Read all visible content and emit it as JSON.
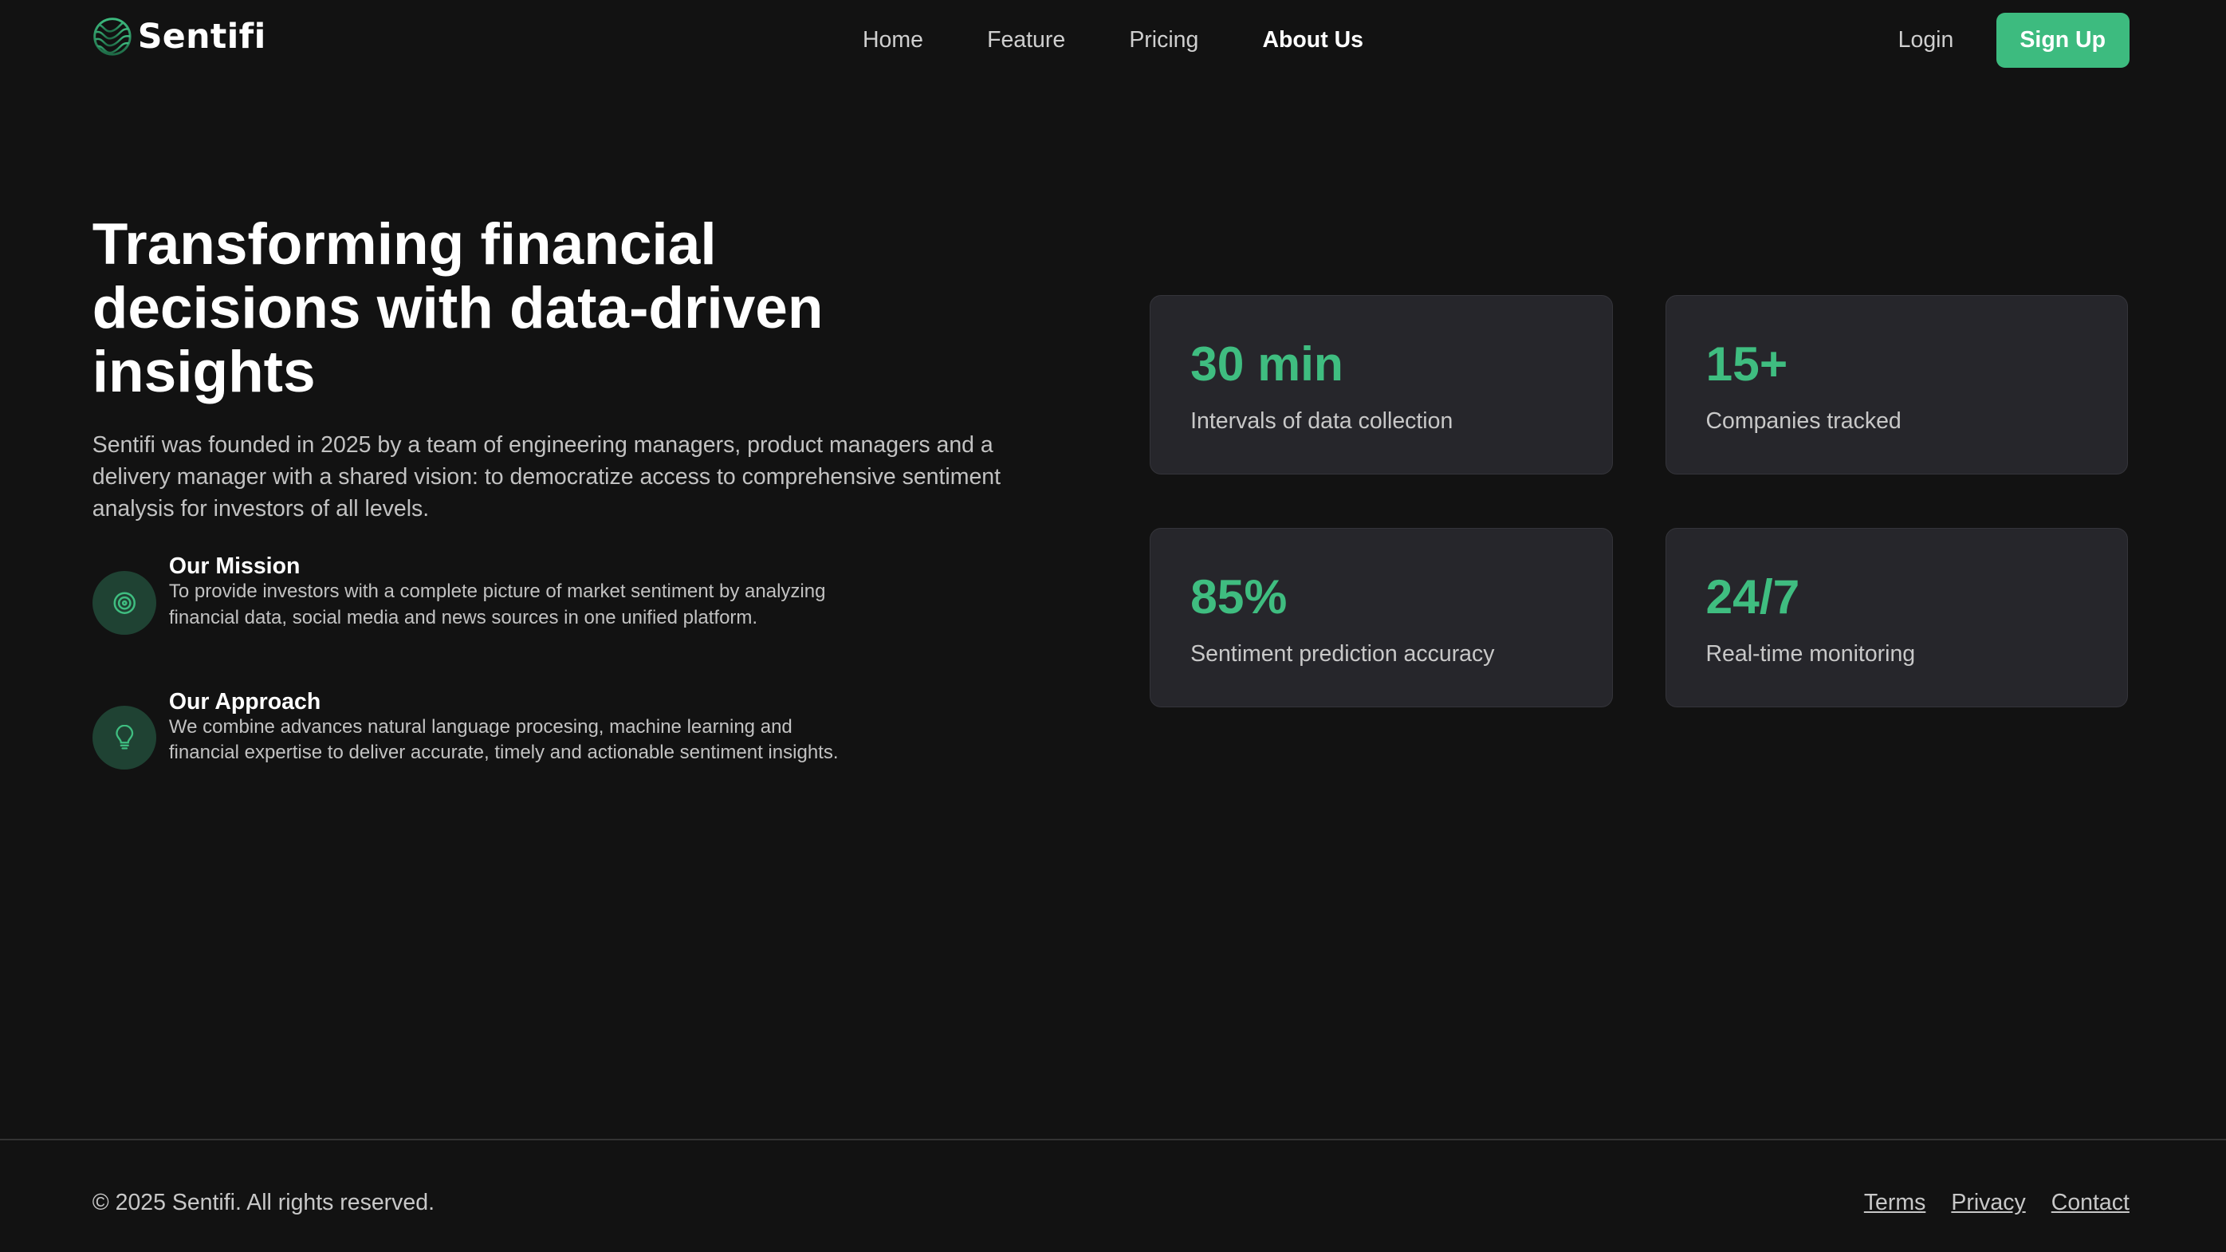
{
  "brand": {
    "name": "Sentifi",
    "accent": "#3dbb7f"
  },
  "nav": {
    "links": [
      "Home",
      "Feature",
      "Pricing",
      "About Us"
    ],
    "active": "About Us",
    "login": "Login",
    "signup": "Sign Up"
  },
  "hero": {
    "title": "Transforming financial decisions with data-driven insights",
    "intro": "Sentifi was founded in 2025 by a team of engineering managers, product managers and a delivery manager with a shared vision: to democratize access to comprehensive sentiment analysis for investors of all levels.",
    "items": [
      {
        "icon": "target-icon",
        "title": "Our Mission",
        "desc": "To provide investors with a complete picture of market sentiment by analyzing financial data, social media and news sources in one unified platform."
      },
      {
        "icon": "lightbulb-icon",
        "title": "Our Approach",
        "desc": "We combine advances natural language procesing, machine learning and financial expertise to deliver accurate, timely and actionable sentiment insights."
      }
    ]
  },
  "stats": [
    {
      "value": "30 min",
      "label": "Intervals of data collection"
    },
    {
      "value": "15+",
      "label": "Companies tracked"
    },
    {
      "value": "85%",
      "label": "Sentiment prediction accuracy"
    },
    {
      "value": "24/7",
      "label": "Real-time monitoring"
    }
  ],
  "footer": {
    "copyright": "© 2025 Sentifi. All rights reserved.",
    "links": [
      "Terms",
      "Privacy",
      "Contact"
    ]
  }
}
